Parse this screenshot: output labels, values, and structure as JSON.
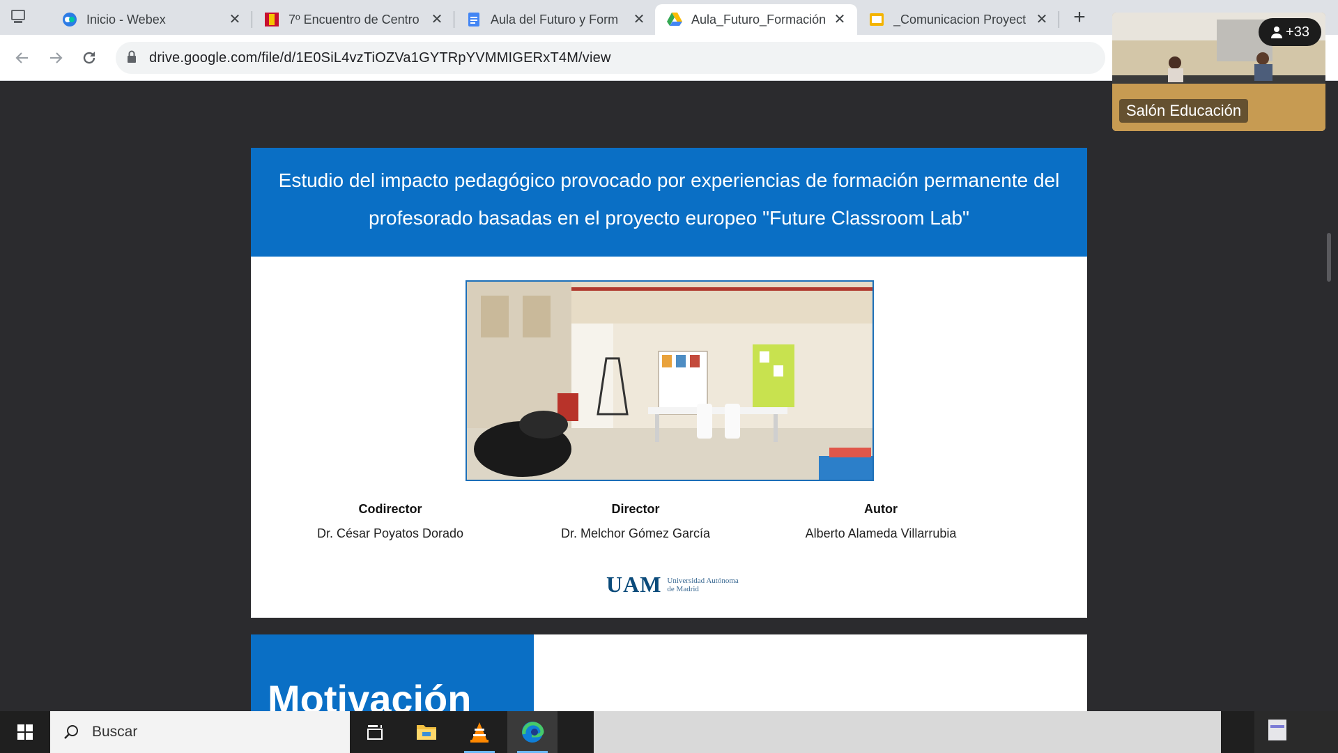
{
  "browser": {
    "tabs": [
      {
        "title": "Inicio - Webex",
        "icon": "webex-icon"
      },
      {
        "title": "7º Encuentro de Centro",
        "icon": "encuentro-icon"
      },
      {
        "title": "Aula del Futuro y Form",
        "icon": "docs-icon"
      },
      {
        "title": "Aula_Futuro_Formación",
        "icon": "drive-icon",
        "active": true
      },
      {
        "title": "_Comunicacion Proyect",
        "icon": "slides-icon"
      }
    ],
    "url": "drive.google.com/file/d/1E0SiL4vzTiOZVa1GYTRpYVMMIGERxT4M/view"
  },
  "video": {
    "room_label": "Salón Educación",
    "participants": "+33"
  },
  "slide1": {
    "title": "Estudio del impacto pedagógico provocado por experiencias de formación permanente del profesorado basadas en el proyecto europeo \"Future Classroom Lab\"",
    "people": [
      {
        "role": "Codirector",
        "name": "Dr. César Poyatos Dorado"
      },
      {
        "role": "Director",
        "name": "Dr. Melchor Gómez García"
      },
      {
        "role": "Autor",
        "name": "Alberto Alameda Villarrubia"
      }
    ],
    "logo_mark": "UAM",
    "logo_line1": "Universidad Autónoma",
    "logo_line2": "de Madrid"
  },
  "slide2": {
    "title": "Motivación"
  },
  "taskbar": {
    "search_placeholder": "Buscar"
  },
  "colors": {
    "slide_blue": "#0a6fc5",
    "tab_strip": "#dee1e6"
  }
}
